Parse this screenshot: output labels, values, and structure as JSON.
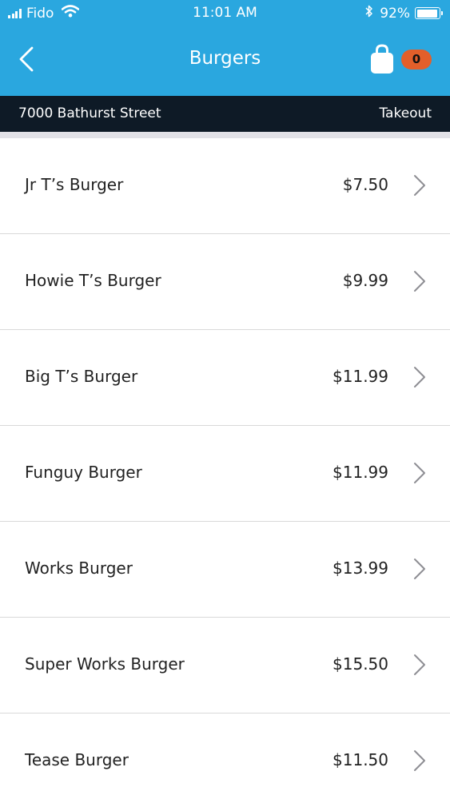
{
  "status_bar": {
    "carrier": "Fido",
    "time": "11:01 AM",
    "battery": "92%"
  },
  "nav": {
    "title": "Burgers",
    "cart_count": "0"
  },
  "location_bar": {
    "address": "7000 Bathurst Street",
    "order_type": "Takeout"
  },
  "menu": {
    "items": [
      {
        "name": "Jr T’s Burger",
        "price": "$7.50"
      },
      {
        "name": "Howie T’s Burger",
        "price": "$9.99"
      },
      {
        "name": "Big T’s Burger",
        "price": "$11.99"
      },
      {
        "name": "Funguy Burger",
        "price": "$11.99"
      },
      {
        "name": "Works Burger",
        "price": "$13.99"
      },
      {
        "name": "Super Works Burger",
        "price": "$15.50"
      },
      {
        "name": "Tease Burger",
        "price": "$11.50"
      }
    ]
  },
  "colors": {
    "header": "#2aa7df",
    "location_bar": "#0e1a26",
    "badge": "#e35f2a"
  }
}
